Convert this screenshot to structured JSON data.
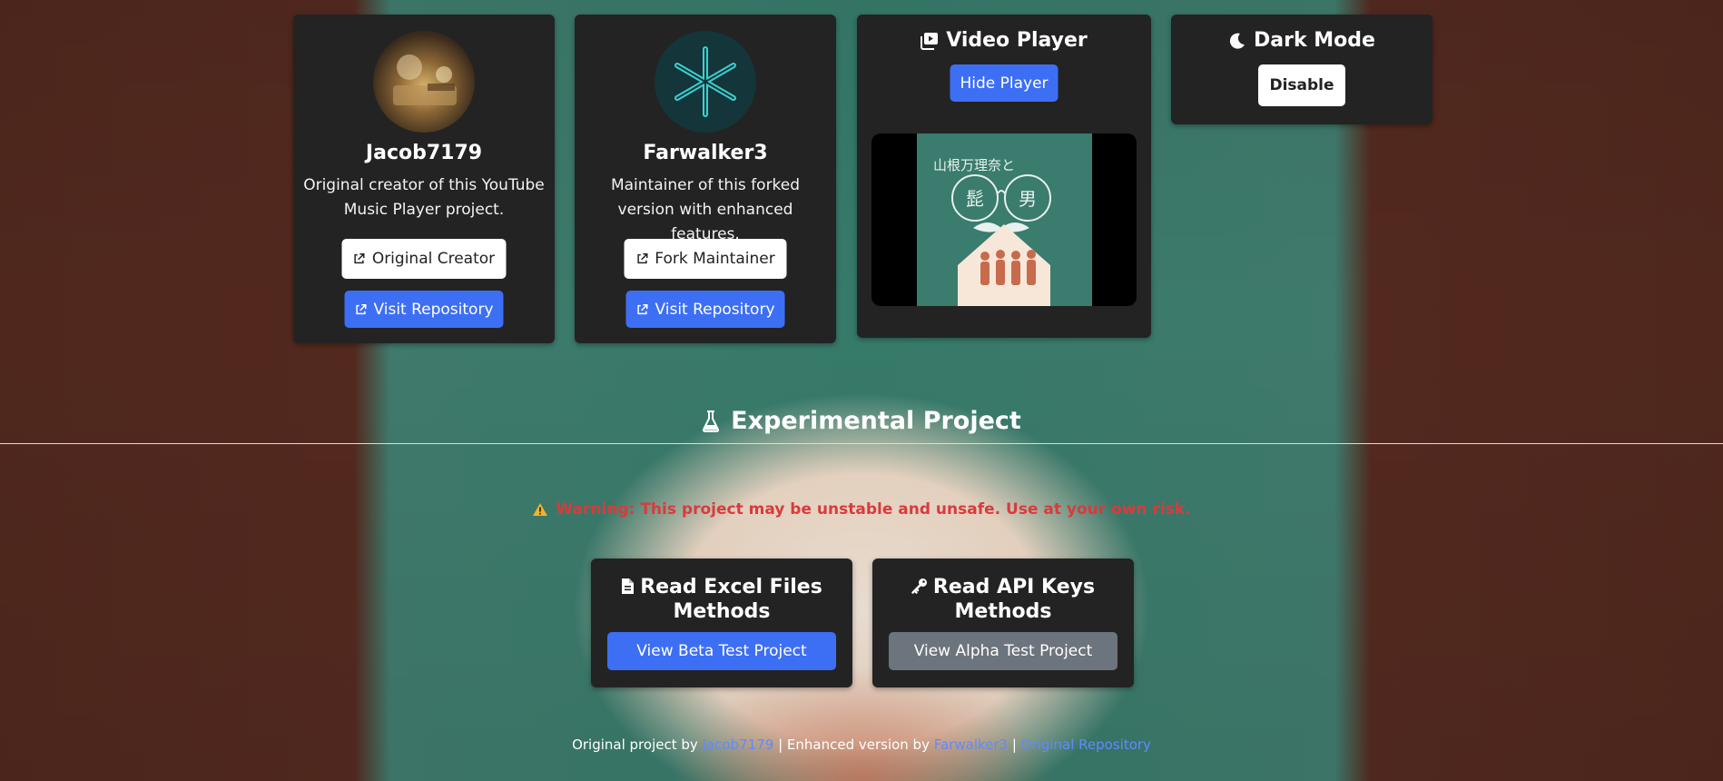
{
  "creators": [
    {
      "name": "Jacob7179",
      "description": "Original creator of this YouTube Music Player project.",
      "profile_button": "Original Creator",
      "repo_button": "Visit Repository",
      "avatar": "photo-avatar"
    },
    {
      "name": "Farwalker3",
      "description": "Maintainer of this forked version with enhanced features.",
      "profile_button": "Fork Maintainer",
      "repo_button": "Visit Repository",
      "avatar": "asterisk-logo-avatar"
    }
  ],
  "video_player": {
    "title": "Video Player",
    "icon": "video-icon",
    "toggle_button": "Hide Player",
    "cover_text_vertical": "山根万理奈と",
    "cover_glyph_left": "髭",
    "cover_glyph_right": "男"
  },
  "dark_mode": {
    "title": "Dark Mode",
    "icon": "moon-icon",
    "button": "Disable"
  },
  "experimental": {
    "title": "Experimental Project",
    "icon": "flask-icon",
    "warning": "Warning: This project may be unstable and unsafe. Use at your own risk.",
    "warning_icon": "warning-icon",
    "projects": [
      {
        "title": "Read Excel Files Methods",
        "icon": "document-icon",
        "button": "View Beta Test Project"
      },
      {
        "title": "Read API Keys Methods",
        "icon": "key-icon",
        "button": "View Alpha Test Project"
      }
    ]
  },
  "footer": {
    "prefix": "Original project by",
    "author": "Jacob7179",
    "middle": "| Enhanced version by",
    "maintainer": "Farwalker3",
    "separator": "|",
    "repo_link": "Original Repository"
  },
  "colors": {
    "card_bg": "#232323",
    "primary": "#3d6ff5",
    "secondary": "#6c747d",
    "warning": "#d93b3b",
    "link": "#5f8bff"
  }
}
